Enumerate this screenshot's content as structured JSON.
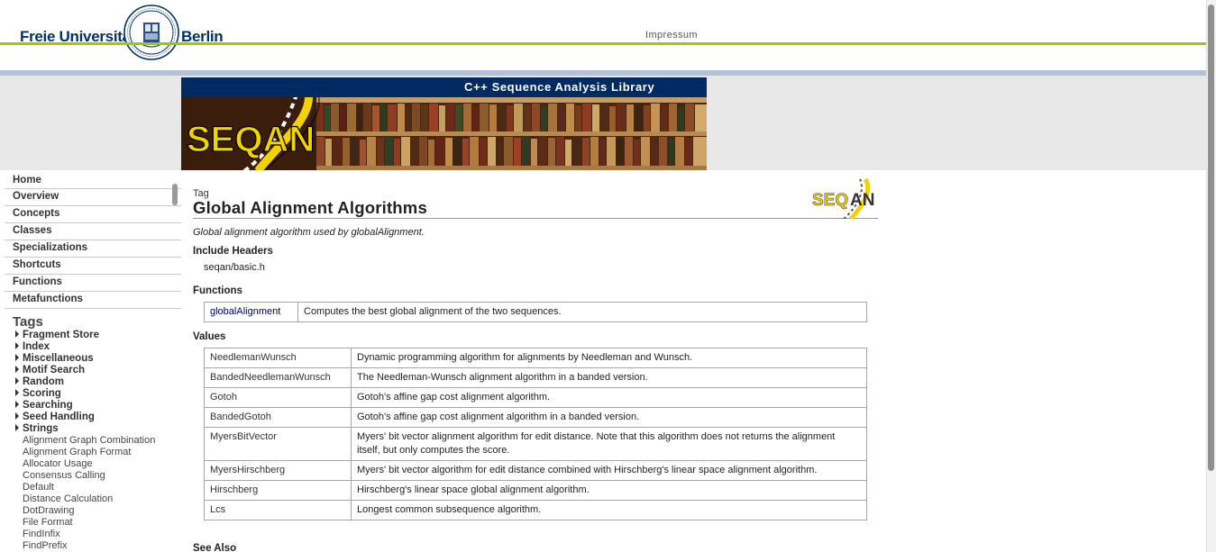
{
  "header": {
    "uni_name_left": "Freie Universität",
    "uni_name_right": "Berlin",
    "impressum": "Impressum"
  },
  "banner": {
    "tagline": "C++ Sequence Analysis Library",
    "logo_text": "SEQAN"
  },
  "sidebar": {
    "nav": [
      "Home",
      "Overview",
      "Concepts",
      "Classes",
      "Specializations",
      "Shortcuts",
      "Functions",
      "Metafunctions"
    ],
    "tags_heading": "Tags",
    "tag_groups": [
      "Fragment Store",
      "Index",
      "Miscellaneous",
      "Motif Search",
      "Random",
      "Scoring",
      "Searching",
      "Seed Handling",
      "Strings"
    ],
    "tag_items": [
      "Alignment Graph Combination",
      "Alignment Graph Format",
      "Allocator Usage",
      "Consensus Calling",
      "Default",
      "Distance Calculation",
      "DotDrawing",
      "File Format",
      "FindInfix",
      "FindPrefix"
    ]
  },
  "content": {
    "kind": "Tag",
    "title": "Global Alignment Algorithms",
    "summary": "Global alignment algorithm used by globalAlignment.",
    "include_heading": "Include Headers",
    "include_file": "seqan/basic.h",
    "functions_heading": "Functions",
    "functions": [
      {
        "name": "globalAlignment",
        "desc": "Computes the best global alignment of the two sequences."
      }
    ],
    "values_heading": "Values",
    "values": [
      {
        "name": "NeedlemanWunsch",
        "desc": "Dynamic programming algorithm for alignments by Needleman and Wunsch."
      },
      {
        "name": "BandedNeedlemanWunsch",
        "desc": "The Needleman-Wunsch alignment algorithm in a banded version."
      },
      {
        "name": "Gotoh",
        "desc": "Gotoh's affine gap cost alignment algorithm."
      },
      {
        "name": "BandedGotoh",
        "desc": "Gotoh's affine gap cost alignment algorithm in a banded version."
      },
      {
        "name": "MyersBitVector",
        "desc": "Myers' bit vector alignment algorithm for edit distance. Note that this algorithm does not returns the alignment itself, but only computes the score."
      },
      {
        "name": "MyersHirschberg",
        "desc": "Myers' bit vector algorithm for edit distance combined with Hirschberg's linear space alignment algorithm."
      },
      {
        "name": "Hirschberg",
        "desc": "Hirschberg's linear space global alignment algorithm."
      },
      {
        "name": "Lcs",
        "desc": "Longest common subsequence algorithm."
      }
    ],
    "see_also_heading": "See Also"
  },
  "colors": {
    "fu_blue": "#003366",
    "fu_green": "#99cc00",
    "banner_navy": "#002a62",
    "seqan_yellow": "#f2d300",
    "link": "#000066"
  }
}
